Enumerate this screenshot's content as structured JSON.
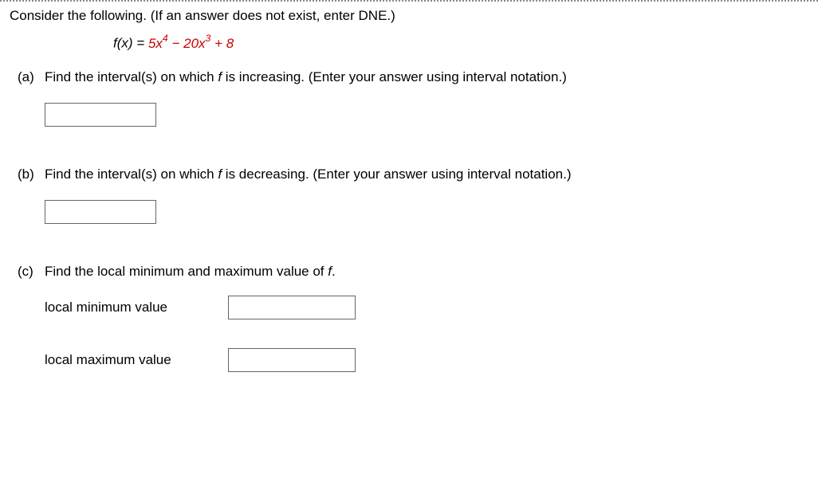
{
  "intro": "Consider the following. (If an answer does not exist, enter DNE.)",
  "formula": {
    "lhs": "f",
    "var": "x",
    "rhs": {
      "a": "5",
      "e1": "4",
      "op1": " − ",
      "b": "20",
      "e2": "3",
      "op2": " + ",
      "c": "8"
    }
  },
  "parts": {
    "a": {
      "label": "(a)",
      "text_before": "Find the interval(s) on which ",
      "f": "f",
      "text_after": " is increasing. (Enter your answer using interval notation.)",
      "value": ""
    },
    "b": {
      "label": "(b)",
      "text_before": "Find the interval(s) on which ",
      "f": "f",
      "text_after": " is decreasing. (Enter your answer using interval notation.)",
      "value": ""
    },
    "c": {
      "label": "(c)",
      "text_before": "Find the local minimum and maximum value of ",
      "f": "f",
      "text_after": ".",
      "min_label": "local minimum value",
      "min_value": "",
      "max_label": "local maximum value",
      "max_value": ""
    }
  }
}
